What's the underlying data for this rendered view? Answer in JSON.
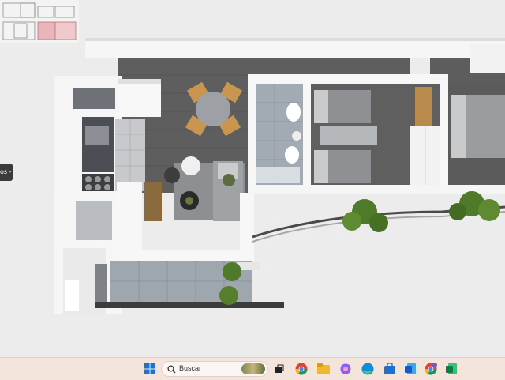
{
  "viewer": {
    "side_tab_label": "os -"
  },
  "taskbar": {
    "search_placeholder": "Buscar",
    "icons": [
      "windows-start-icon",
      "search-icon",
      "task-view-icon",
      "chrome-icon",
      "file-explorer-icon",
      "copilot-icon",
      "edge-icon",
      "microsoft-store-icon",
      "word-icon",
      "chrome-profile-icon",
      "excel-icon"
    ]
  },
  "colors": {
    "wall": "#f7f7f7",
    "floor_dark": "#5d5d5d",
    "tile": "#9aa2ab",
    "taskbar": "#f3e4dc"
  }
}
